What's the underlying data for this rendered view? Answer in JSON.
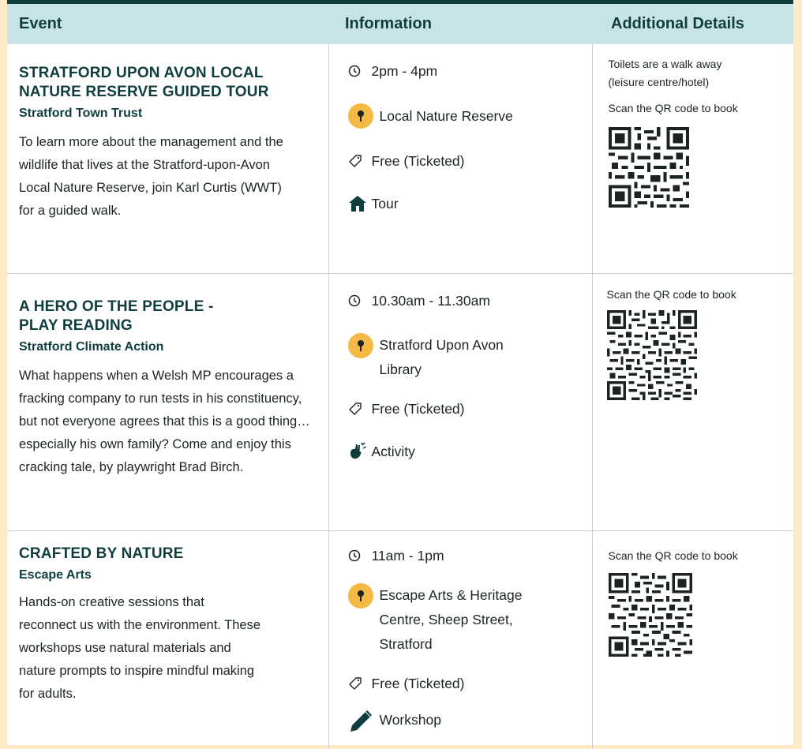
{
  "headers": {
    "event": "Event",
    "information": "Information",
    "additional": "Additional Details"
  },
  "colors": {
    "header_bg": "#c8e3e5",
    "header_text": "#0f3d3e",
    "accent_pin": "#f4b942",
    "page_bg": "#fde9c3"
  },
  "events": [
    {
      "title": "STRATFORD UPON AVON LOCAL NATURE RESERVE GUIDED TOUR",
      "organiser": "Stratford Town Trust",
      "description": "To learn more about the management and the wildlife that lives at the Stratford-upon-Avon Local Nature Reserve, join Karl Curtis (WWT) for a guided walk.",
      "time": "2pm - 4pm",
      "location": "Local Nature Reserve",
      "price": "Free (Ticketed)",
      "type": "Tour",
      "type_icon": "house-icon",
      "note": "Toilets are a walk away (leisure centre/hotel)",
      "qr_caption": "Scan the QR code to book"
    },
    {
      "title": "A HERO OF THE PEOPLE - PLAY READING",
      "organiser": "Stratford Climate Action",
      "description": "What happens when a Welsh MP encourages a fracking company to run tests in his constituency, but not everyone agrees that this is a good thing… especially his own family? Come and enjoy this cracking tale, by playwright Brad Birch.",
      "time": "10.30am - 11.30am",
      "location": "Stratford Upon Avon Library",
      "price": "Free (Ticketed)",
      "type": "Activity",
      "type_icon": "handprint-icon",
      "qr_caption": "Scan the QR code to book"
    },
    {
      "title": "CRAFTED BY NATURE",
      "organiser": "Escape Arts",
      "description": "Hands-on creative sessions that reconnect us with the environment. These workshops use natural materials and nature prompts to inspire mindful making for adults.",
      "time": "11am - 1pm",
      "location": "Escape Arts & Heritage Centre, Sheep Street, Stratford",
      "price": "Free (Ticketed)",
      "type": "Workshop",
      "type_icon": "pencil-icon",
      "qr_caption": "Scan the QR code to book"
    }
  ]
}
